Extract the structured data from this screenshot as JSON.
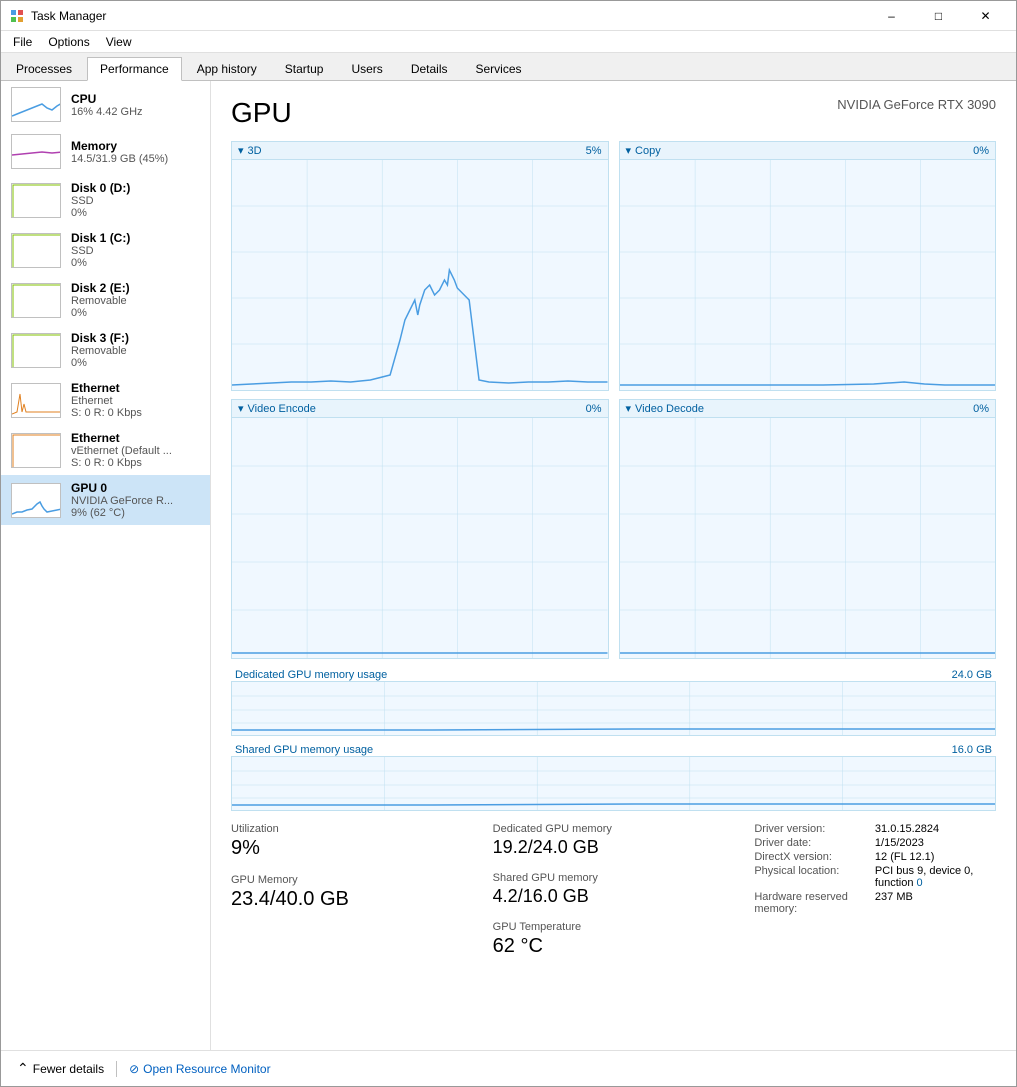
{
  "window": {
    "title": "Task Manager",
    "controls": {
      "minimize": "–",
      "maximize": "□",
      "close": "✕"
    }
  },
  "menu": {
    "items": [
      "File",
      "Options",
      "View"
    ]
  },
  "tabs": [
    {
      "label": "Processes",
      "active": false
    },
    {
      "label": "Performance",
      "active": true
    },
    {
      "label": "App history",
      "active": false
    },
    {
      "label": "Startup",
      "active": false
    },
    {
      "label": "Users",
      "active": false
    },
    {
      "label": "Details",
      "active": false
    },
    {
      "label": "Services",
      "active": false
    }
  ],
  "sidebar": {
    "items": [
      {
        "id": "cpu",
        "label": "CPU",
        "sub": "16% 4.42 GHz",
        "value": "",
        "active": false
      },
      {
        "id": "memory",
        "label": "Memory",
        "sub": "14.5/31.9 GB (45%)",
        "value": "",
        "active": false
      },
      {
        "id": "disk0",
        "label": "Disk 0 (D:)",
        "sub": "SSD",
        "value": "0%",
        "active": false
      },
      {
        "id": "disk1",
        "label": "Disk 1 (C:)",
        "sub": "SSD",
        "value": "0%",
        "active": false
      },
      {
        "id": "disk2",
        "label": "Disk 2 (E:)",
        "sub": "Removable",
        "value": "0%",
        "active": false
      },
      {
        "id": "disk3",
        "label": "Disk 3 (F:)",
        "sub": "Removable",
        "value": "0%",
        "active": false
      },
      {
        "id": "ethernet1",
        "label": "Ethernet",
        "sub": "Ethernet",
        "value": "S: 0  R: 0 Kbps",
        "active": false
      },
      {
        "id": "ethernet2",
        "label": "Ethernet",
        "sub": "vEthernet (Default ...",
        "value": "S: 0  R: 0 Kbps",
        "active": false
      },
      {
        "id": "gpu0",
        "label": "GPU 0",
        "sub": "NVIDIA GeForce R...",
        "value": "9% (62 °C)",
        "active": true
      }
    ]
  },
  "main": {
    "title": "GPU",
    "model": "NVIDIA GeForce RTX 3090",
    "charts": {
      "row1": [
        {
          "label": "3D",
          "value": "5%"
        },
        {
          "label": "Copy",
          "value": "0%"
        }
      ],
      "row2": [
        {
          "label": "Video Encode",
          "value": "0%"
        },
        {
          "label": "Video Decode",
          "value": "0%"
        }
      ]
    },
    "dedicated_memory": {
      "label": "Dedicated GPU memory usage",
      "max": "24.0 GB"
    },
    "shared_memory": {
      "label": "Shared GPU memory usage",
      "max": "16.0 GB"
    },
    "stats": {
      "utilization_label": "Utilization",
      "utilization_value": "9%",
      "gpu_memory_label": "GPU Memory",
      "gpu_memory_value": "23.4/40.0 GB",
      "dedicated_label": "Dedicated GPU memory",
      "dedicated_value": "19.2/24.0 GB",
      "shared_label": "Shared GPU memory",
      "shared_value": "4.2/16.0 GB",
      "temp_label": "GPU Temperature",
      "temp_value": "62 °C"
    },
    "info": {
      "driver_version_label": "Driver version:",
      "driver_version_value": "31.0.15.2824",
      "driver_date_label": "Driver date:",
      "driver_date_value": "1/15/2023",
      "directx_label": "DirectX version:",
      "directx_value": "12 (FL 12.1)",
      "physical_location_label": "Physical location:",
      "physical_location_value": "PCI bus 9, device 0, function 0",
      "hardware_reserved_label": "Hardware reserved memory:",
      "hardware_reserved_value": "237 MB"
    }
  },
  "bottom": {
    "fewer_details": "Fewer details",
    "open_resource_monitor": "Open Resource Monitor"
  }
}
